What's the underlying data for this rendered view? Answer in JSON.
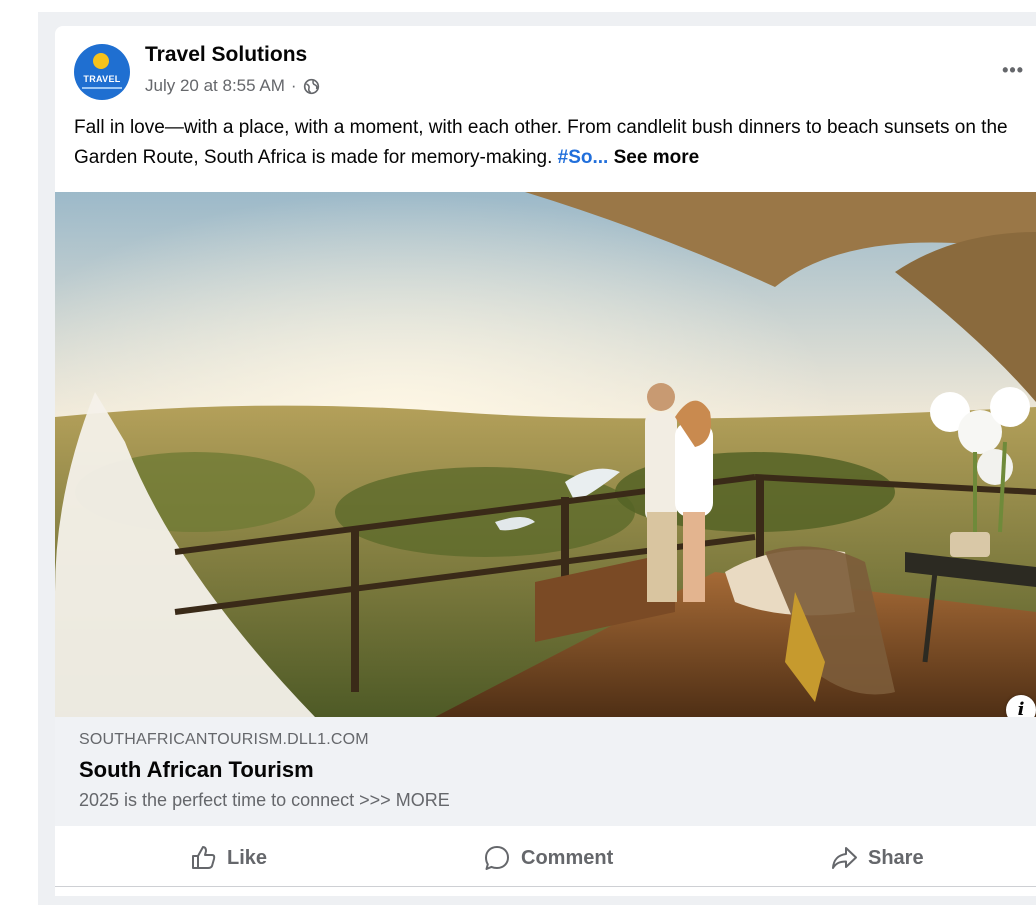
{
  "post": {
    "author": "Travel Solutions",
    "avatar_text": "TRAVEL",
    "timestamp": "July 20 at 8:55 AM",
    "separator": "·",
    "audience_icon": "globe-icon",
    "more_icon": "more-options-icon",
    "more_glyph": "•••",
    "text_main": "Fall in love—with a place, with a moment, with each other. From candlelit bush dinners to beach sunsets on the Garden Route, South Africa is made for memory-making.",
    "hashtag": "#So...",
    "see_more": "See more"
  },
  "link_preview": {
    "domain": "SOUTHAFRICANTOURISM.DLL1.COM",
    "title": "South African Tourism",
    "description": "2025 is the perfect time to connect >>> MORE",
    "info_glyph": "i"
  },
  "actions": {
    "like": "Like",
    "comment": "Comment",
    "share": "Share"
  },
  "colors": {
    "hashtag": "#216fdb",
    "secondary_text": "#65676b",
    "link_box_bg": "#f0f2f5",
    "feed_bg": "#eef0f3"
  }
}
